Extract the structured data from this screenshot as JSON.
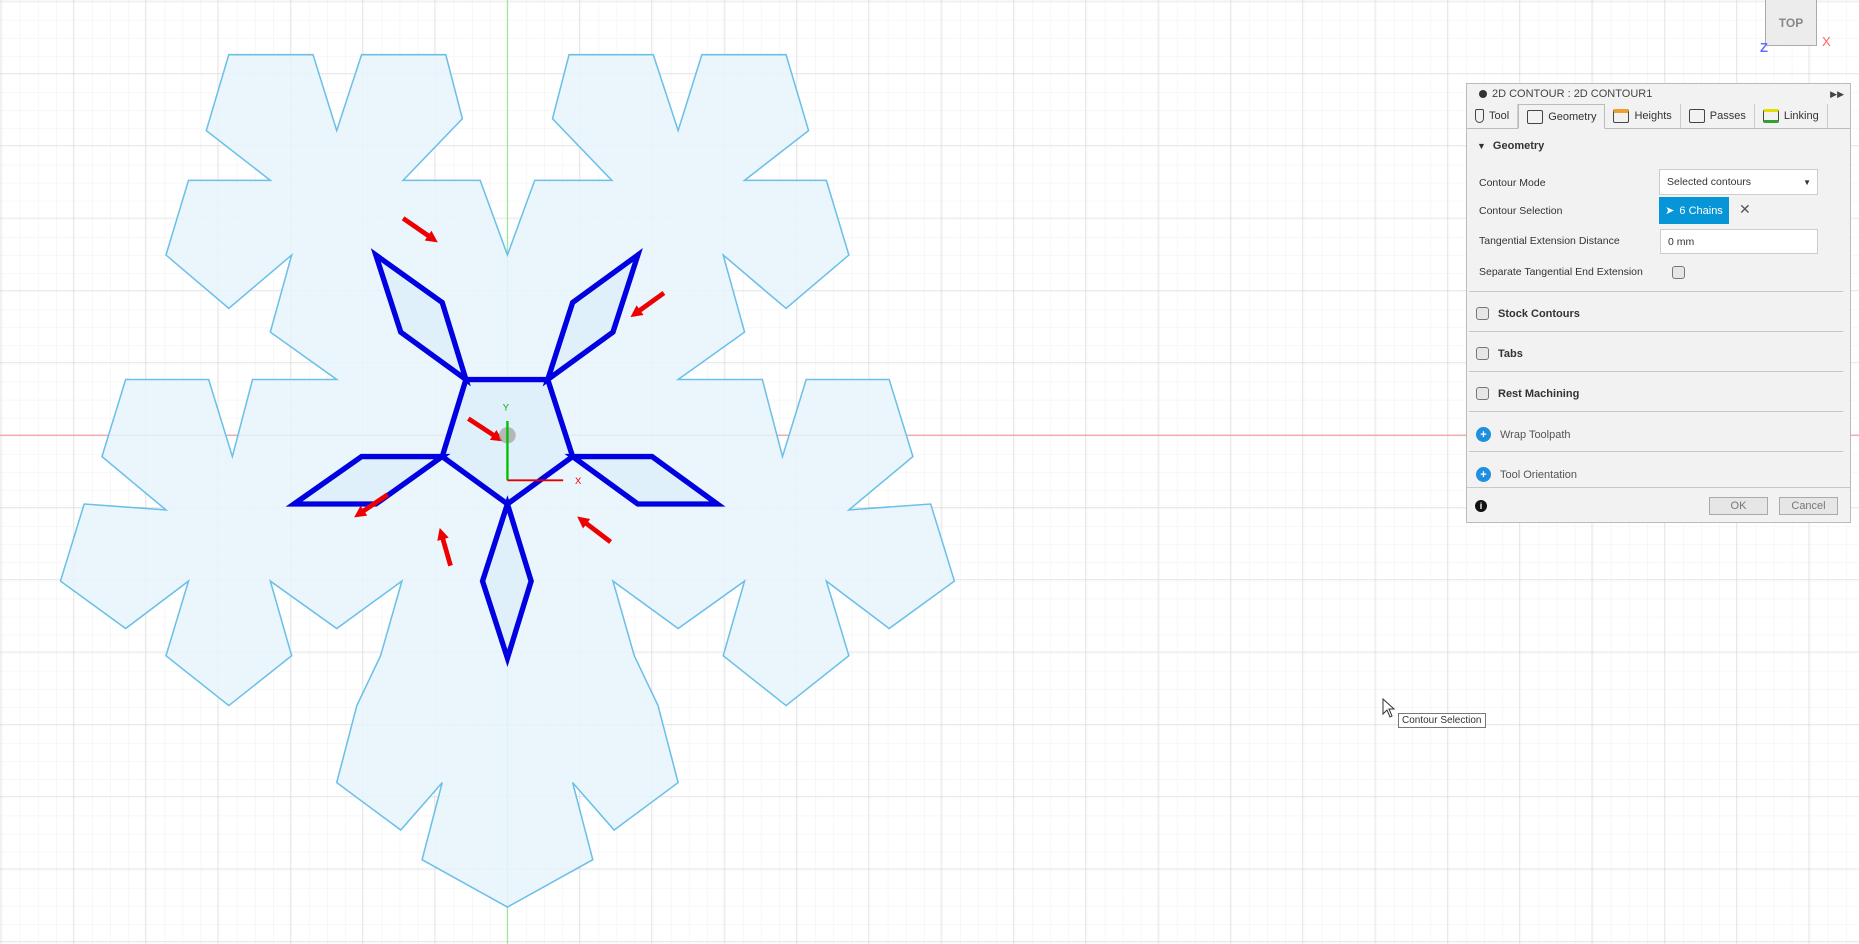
{
  "viewport": {
    "view_cube_label": "TOP",
    "axis_z": "Z",
    "axis_x": "X",
    "origin_labels": {
      "y": "Y",
      "x": "X"
    },
    "colors": {
      "outline": "#6cc0e8",
      "fill": "#e6f4fb",
      "selected": "#0000e0",
      "arrow": "#ee0000",
      "grid": "#dcdcdc"
    }
  },
  "panel": {
    "title": "2D CONTOUR : 2D CONTOUR1",
    "tabs": [
      {
        "label": "Tool",
        "icon": "tool-icon"
      },
      {
        "label": "Geometry",
        "icon": "geometry-icon",
        "active": true
      },
      {
        "label": "Heights",
        "icon": "heights-icon"
      },
      {
        "label": "Passes",
        "icon": "passes-icon"
      },
      {
        "label": "Linking",
        "icon": "linking-icon"
      }
    ],
    "geometry": {
      "header": "Geometry",
      "contour_mode_label": "Contour Mode",
      "contour_mode_value": "Selected contours",
      "contour_selection_label": "Contour Selection",
      "contour_selection_value": "6 Chains",
      "tangential_label": "Tangential Extension Distance",
      "tangential_value": "0 mm",
      "separate_label": "Separate Tangential End Extension",
      "separate_checked": false
    },
    "sections": [
      {
        "label": "Stock Contours",
        "checked": false
      },
      {
        "label": "Tabs",
        "checked": false
      },
      {
        "label": "Rest Machining",
        "checked": false
      }
    ],
    "expanders": [
      "Wrap Toolpath",
      "Tool Orientation"
    ],
    "ok": "OK",
    "cancel": "Cancel"
  },
  "tooltip": "Contour Selection"
}
